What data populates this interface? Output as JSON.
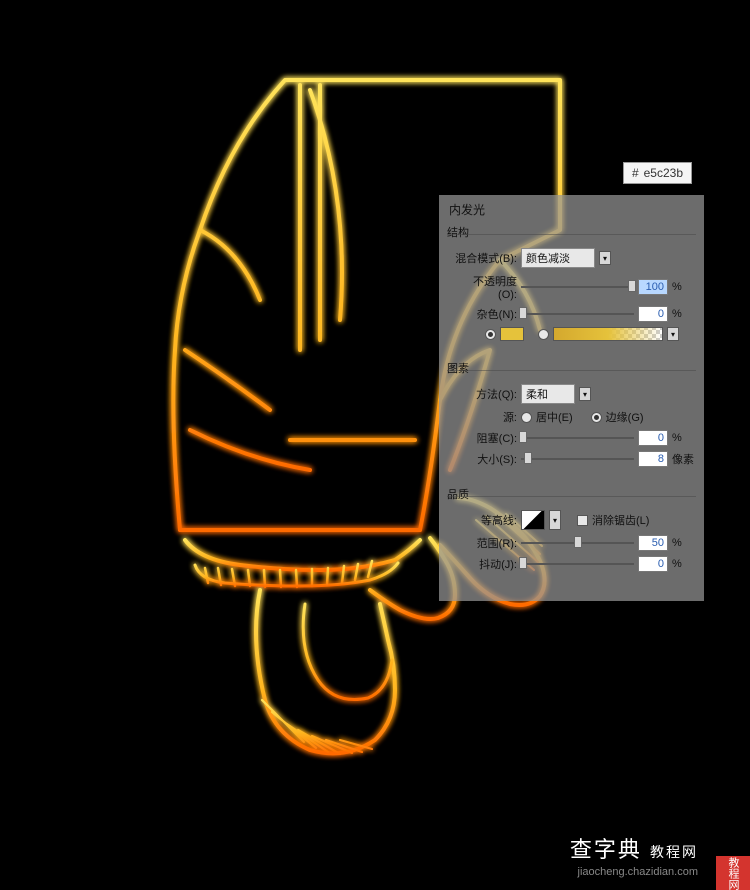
{
  "hex_badge": {
    "hash": "#",
    "value": "e5c23b"
  },
  "panel": {
    "title": "内发光",
    "groups": {
      "structure": {
        "name": "结构",
        "blend_mode": {
          "label": "混合模式(B):",
          "value": "颜色减淡"
        },
        "opacity": {
          "label": "不透明度(O):",
          "value": "100",
          "unit": "%"
        },
        "noise": {
          "label": "杂色(N):",
          "value": "0",
          "unit": "%"
        }
      },
      "elements": {
        "name": "图素",
        "technique": {
          "label": "方法(Q):",
          "value": "柔和"
        },
        "source": {
          "label": "源:",
          "center": "居中(E)",
          "edge": "边缘(G)"
        },
        "choke": {
          "label": "阻塞(C):",
          "value": "0",
          "unit": "%"
        },
        "size": {
          "label": "大小(S):",
          "value": "8",
          "unit": "像素"
        }
      },
      "quality": {
        "name": "品质",
        "contour": {
          "label": "等高线:",
          "antialias": "消除锯齿(L)"
        },
        "range": {
          "label": "范围(R):",
          "value": "50",
          "unit": "%"
        },
        "jitter": {
          "label": "抖动(J):",
          "value": "0",
          "unit": "%"
        }
      }
    }
  },
  "watermark": {
    "title": "查字典",
    "subtitle": "教程网",
    "url": "jiaocheng.chazidian.com"
  }
}
